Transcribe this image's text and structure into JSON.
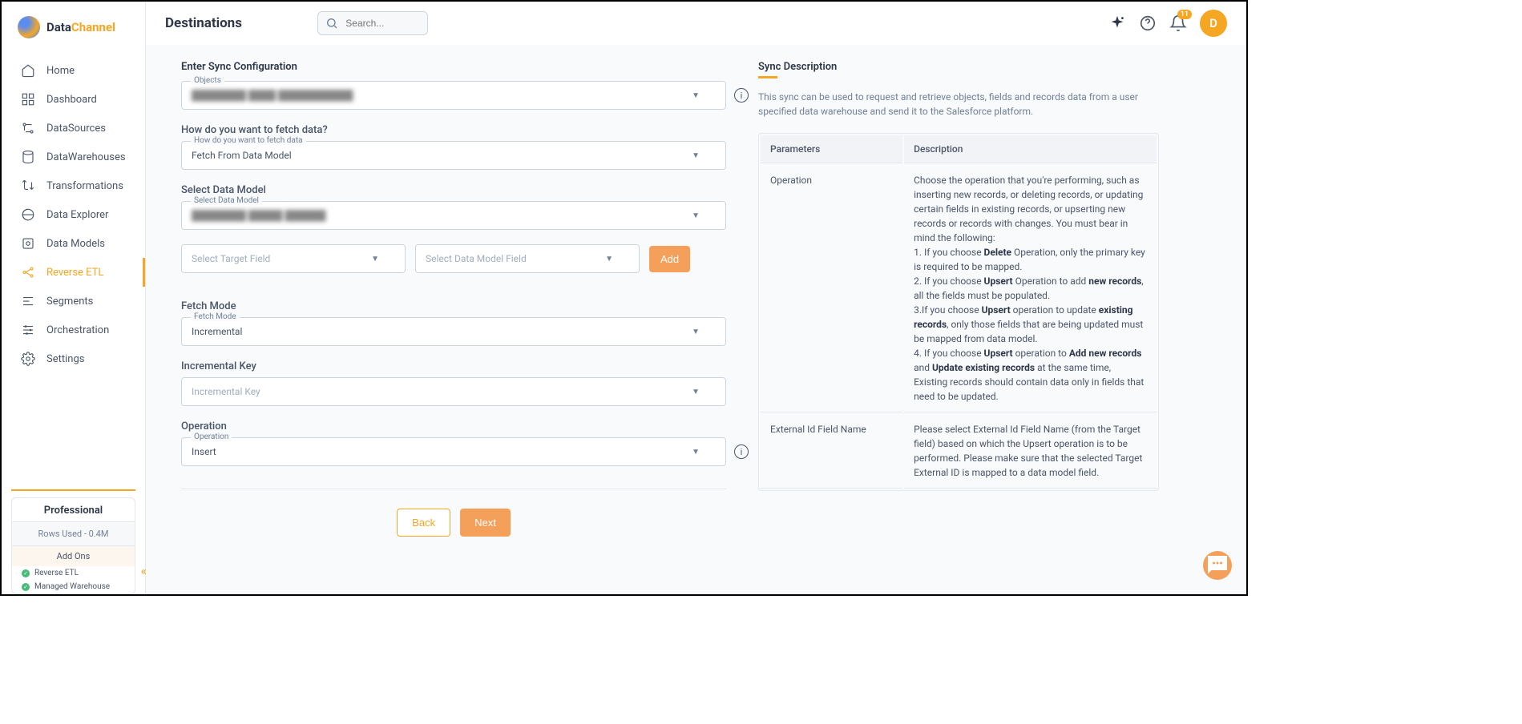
{
  "logo": {
    "part1": "Data",
    "part2": "Channel"
  },
  "nav": [
    {
      "label": "Home"
    },
    {
      "label": "Dashboard"
    },
    {
      "label": "DataSources"
    },
    {
      "label": "DataWarehouses"
    },
    {
      "label": "Transformations"
    },
    {
      "label": "Data Explorer"
    },
    {
      "label": "Data Models"
    },
    {
      "label": "Reverse ETL"
    },
    {
      "label": "Segments"
    },
    {
      "label": "Orchestration"
    },
    {
      "label": "Settings"
    }
  ],
  "plan": {
    "name": "Professional",
    "rows": "Rows Used - 0.4M",
    "addons_label": "Add Ons",
    "addons": [
      "Reverse ETL",
      "Managed Warehouse"
    ]
  },
  "page_title": "Destinations",
  "search_placeholder": "Search...",
  "notif_count": "11",
  "avatar_letter": "D",
  "form": {
    "section_title": "Enter Sync Configuration",
    "objects": {
      "float": "Objects",
      "value": "████████ ████ ███████████"
    },
    "fetch_q": "How do you want to fetch data?",
    "fetch_data": {
      "float": "How do you want to fetch data",
      "value": "Fetch From Data Model"
    },
    "select_model_label": "Select Data Model",
    "select_model": {
      "float": "Select Data Model",
      "value": "████████ █████ ██████"
    },
    "target_field_placeholder": "Select Target Field",
    "model_field_placeholder": "Select Data Model Field",
    "add_label": "Add",
    "fetch_mode_label": "Fetch Mode",
    "fetch_mode": {
      "float": "Fetch Mode",
      "value": "Incremental"
    },
    "incr_key_label": "Incremental Key",
    "incr_key_placeholder": "Incremental Key",
    "operation_label": "Operation",
    "operation": {
      "float": "Operation",
      "value": "Insert"
    },
    "back_label": "Back",
    "next_label": "Next"
  },
  "desc": {
    "title": "Sync Description",
    "text": "This sync can be used to request and retrieve objects, fields and records data from a user specified data warehouse and send it to the Salesforce platform.",
    "th1": "Parameters",
    "th2": "Description",
    "rows": [
      {
        "param": "Operation"
      },
      {
        "param": "External Id Field Name"
      }
    ],
    "row2_desc": "Please select External Id Field Name (from the Target field) based on which the Upsert operation is to be performed. Please make sure that the selected Target External ID is mapped to a data model field."
  }
}
